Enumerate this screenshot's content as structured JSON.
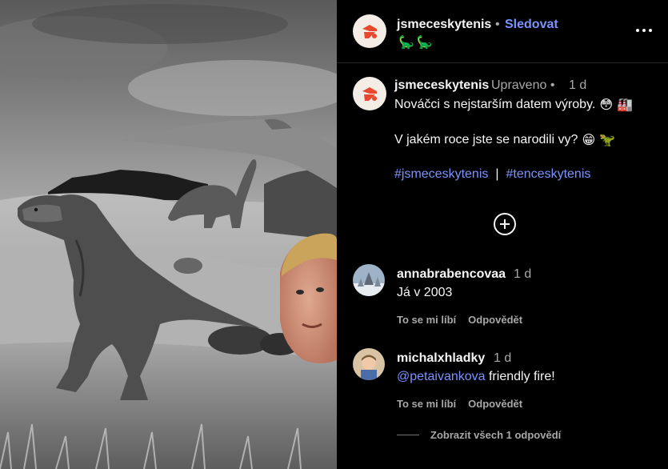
{
  "post": {
    "username": "jsmeceskytenis",
    "follow_label": "Sledovat",
    "header_separator": "•",
    "header_emojis": [
      "🦕",
      "🦕"
    ]
  },
  "caption": {
    "username": "jsmeceskytenis",
    "edited_label": "Upraveno",
    "separator": "•",
    "time": "1 d",
    "line1_text": "Nováčci s nejstarším datem výroby.",
    "line1_emojis": [
      "😳",
      "🏭"
    ],
    "line2_text": "V jakém roce jste se narodili vy?",
    "line2_emojis": [
      "😁",
      "🦖"
    ],
    "hashtag1": "#jsmeceskytenis",
    "hashtag_sep": "|",
    "hashtag2": "#tenceskytenis"
  },
  "comments": [
    {
      "username": "annabrabencovaa",
      "time": "1 d",
      "text": "Já v 2003",
      "like_label": "To se mi líbí",
      "reply_label": "Odpovědět"
    },
    {
      "username": "michalxhladky",
      "time": "1 d",
      "mention": "@petaivankova",
      "text": "friendly fire!",
      "like_label": "To se mi líbí",
      "reply_label": "Odpovědět"
    }
  ],
  "view_replies_label": "Zobrazit všech 1 odpovědí",
  "colors": {
    "accent": "#7a93ff",
    "brand": "#e8482f",
    "muted": "#a8a8a8",
    "background": "#000000"
  },
  "icons": {
    "more": "more-dots-icon",
    "add": "plus-circle-icon",
    "logo": "brand-logo-icon"
  }
}
